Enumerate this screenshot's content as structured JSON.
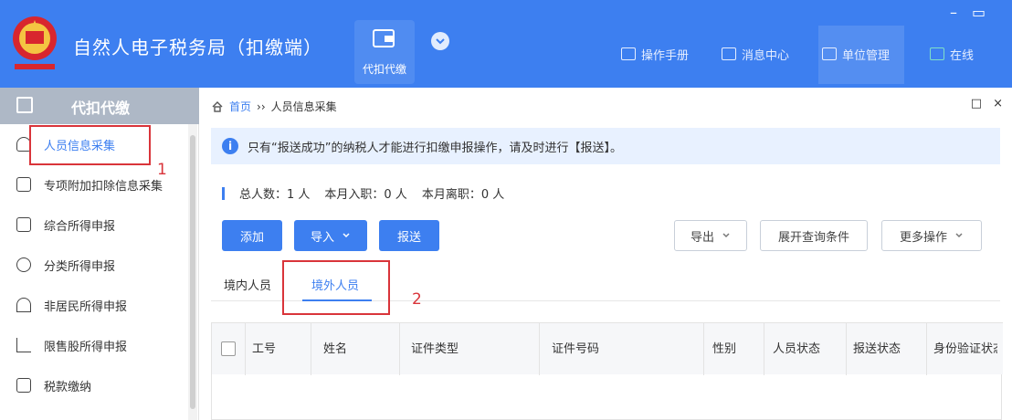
{
  "header": {
    "title": "自然人电子税务局（扣缴端）",
    "module_label": "代扣代缴",
    "links": [
      {
        "label": "操作手册",
        "icon": "book-icon"
      },
      {
        "label": "消息中心",
        "icon": "mail-icon"
      },
      {
        "label": "单位管理",
        "icon": "building-icon"
      },
      {
        "label": "在线",
        "icon": "chat-icon"
      }
    ],
    "window_controls": {
      "minimize": "–",
      "maximize": "▭"
    }
  },
  "sidebar": {
    "header": "代扣代缴",
    "items": [
      {
        "label": "人员信息采集",
        "icon": "user-icon",
        "active": true
      },
      {
        "label": "专项附加扣除信息采集",
        "icon": "list-icon"
      },
      {
        "label": "综合所得申报",
        "icon": "layers-icon"
      },
      {
        "label": "分类所得申报",
        "icon": "clock-icon"
      },
      {
        "label": "非居民所得申报",
        "icon": "person-icon"
      },
      {
        "label": "限售股所得申报",
        "icon": "bar-chart-icon"
      },
      {
        "label": "税款缴纳",
        "icon": "folder-icon"
      }
    ]
  },
  "breadcrumb": {
    "home": "首页",
    "separator": "››",
    "current": "人员信息采集"
  },
  "panel_tools": {
    "restore": "□",
    "close": "×"
  },
  "notice": {
    "icon": "i",
    "text": "只有“报送成功”的纳税人才能进行扣缴申报操作，请及时进行【报送】。"
  },
  "counts": {
    "total": "总人数：1 人",
    "joined": "本月入职：0 人",
    "left": "本月离职：0 人"
  },
  "toolbar": {
    "add": "添加",
    "import": "导入",
    "submit": "报送",
    "export": "导出",
    "expand_query": "展开查询条件",
    "more": "更多操作"
  },
  "tabs": [
    {
      "label": "境内人员"
    },
    {
      "label": "境外人员",
      "active": true
    }
  ],
  "table": {
    "columns": [
      "工号",
      "姓名",
      "证件类型",
      "证件号码",
      "性别",
      "人员状态",
      "报送状态",
      "身份验证状态"
    ]
  },
  "annotations": {
    "marker_1": "1",
    "marker_2": "2"
  },
  "colors": {
    "primary": "#3d7ff0",
    "annotation": "#d9343a",
    "sidebar_header": "#aeb8c6"
  }
}
